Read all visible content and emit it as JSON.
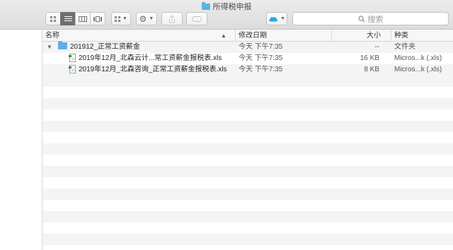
{
  "window": {
    "title": "所得税申报"
  },
  "toolbar": {
    "view_modes": [
      "icon-view",
      "list-view",
      "column-view",
      "cover-flow-view"
    ],
    "active_view": "list-view",
    "search_placeholder": "搜索"
  },
  "columns": {
    "name": "名称",
    "date": "修改日期",
    "size": "大小",
    "kind": "种类"
  },
  "rows": [
    {
      "name": "201912_正常工资薪金",
      "date": "今天 下午7:35",
      "size": "--",
      "kind": "文件夹",
      "icon": "folder-icon",
      "expanded": true
    },
    {
      "name": "2019年12月_北森云计...常工资薪金报税表.xls",
      "date": "今天 下午7:35",
      "size": "16 KB",
      "kind": "Micros...k (.xls)",
      "icon": "xls-file-icon"
    },
    {
      "name": "2019年12月_北森咨询_正常工资薪金报税表.xls",
      "date": "今天 下午7:35",
      "size": "8 KB",
      "kind": "Micros...k (.xls)",
      "icon": "xls-file-icon"
    }
  ],
  "colors": {
    "folder": "#5ab3e8",
    "accent": "#2aa7df"
  }
}
